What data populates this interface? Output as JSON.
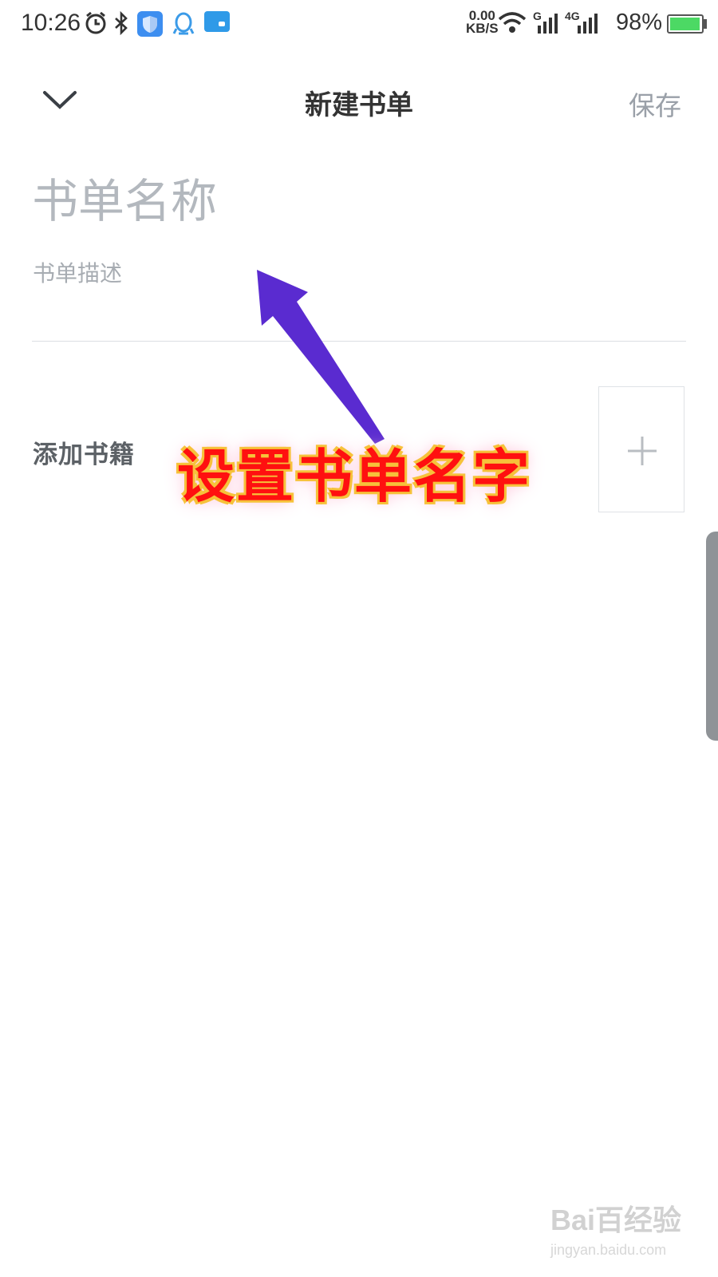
{
  "status_bar": {
    "time": "10:26",
    "net_speed_value": "0.00",
    "net_speed_unit": "KB/S",
    "network_1": "G",
    "network_2": "4G",
    "battery_percent": "98%",
    "battery_level": 0.98,
    "icons": [
      "alarm-icon",
      "bluetooth-icon",
      "shield-app-icon",
      "qq-icon",
      "message-app-icon",
      "wifi-icon",
      "signal-icon",
      "signal-4g-icon",
      "battery-icon"
    ]
  },
  "header": {
    "title": "新建书单",
    "save_label": "保存",
    "back_icon": "chevron-down-icon"
  },
  "form": {
    "name_placeholder": "书单名称",
    "name_value": "",
    "desc_placeholder": "书单描述",
    "desc_value": "",
    "add_books_label": "添加书籍",
    "add_icon": "plus-icon"
  },
  "annotation": {
    "text": "设置书单名字",
    "text_color": "#ff1010",
    "outline_color": "#f6c23a",
    "arrow_color": "#5a2bd0"
  },
  "watermark": {
    "brand": "Bai百经验",
    "url": "jingyan.baidu.com"
  }
}
